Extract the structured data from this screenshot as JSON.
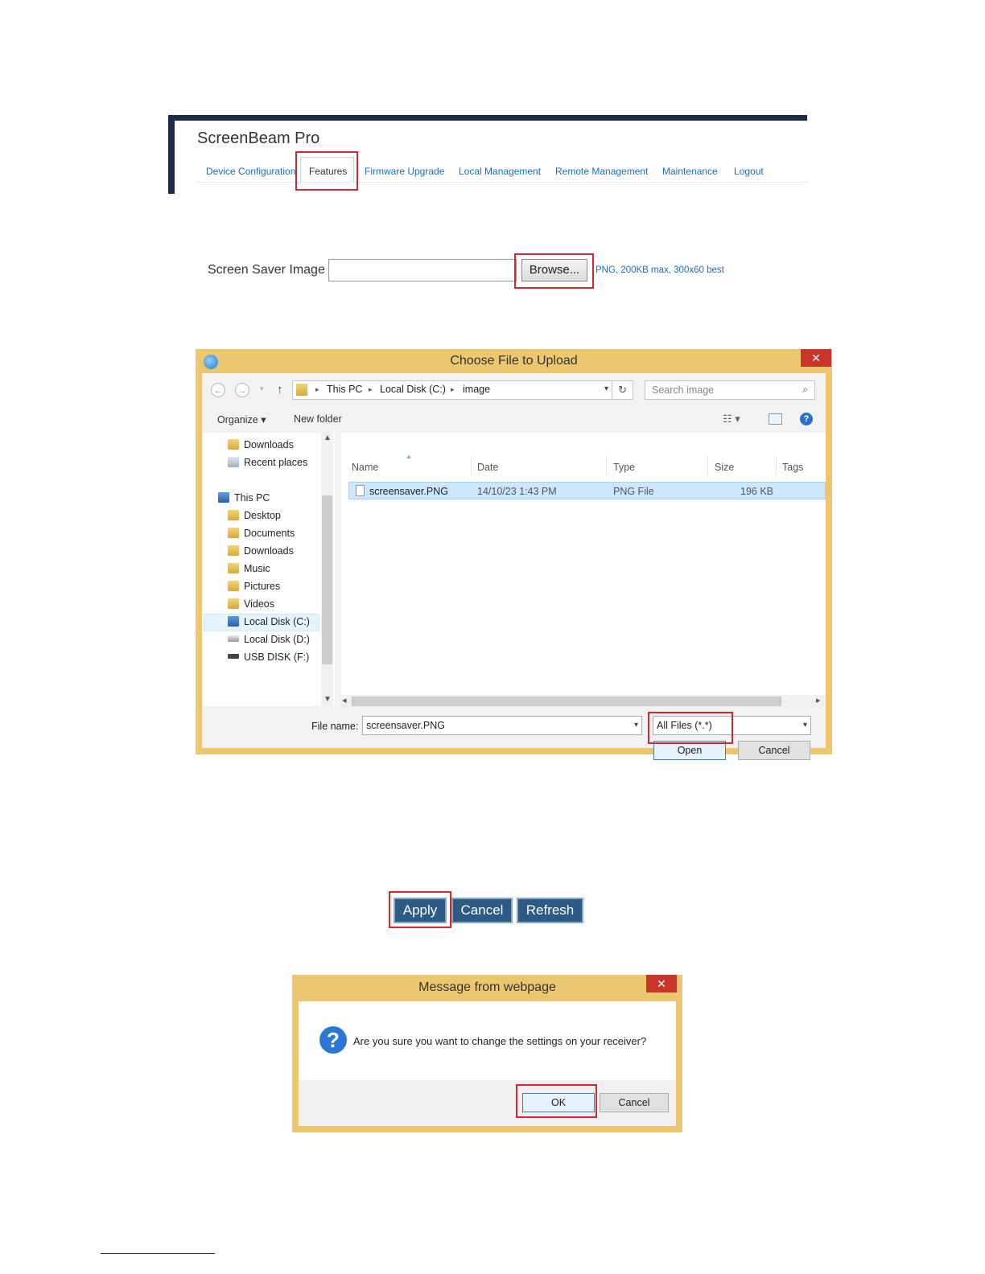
{
  "header": {
    "title": "ScreenBeam Pro",
    "nav": [
      "Device Configuration",
      "Features",
      "Firmware Upgrade",
      "Local Management",
      "Remote Management",
      "Maintenance",
      "Logout"
    ]
  },
  "screen_saver": {
    "label": "Screen Saver Image",
    "input_value": "",
    "browse_label": "Browse...",
    "hint": "PNG, 200KB max, 300x60 best"
  },
  "file_dialog": {
    "title": "Choose File to Upload",
    "close": "✕",
    "breadcrumb": [
      "This PC",
      "Local Disk (C:)",
      "image"
    ],
    "search_placeholder": "Search image",
    "toolbar": {
      "organize": "Organize ▾",
      "new_folder": "New folder"
    },
    "sidebar": {
      "favorites": [
        "Downloads",
        "Recent places"
      ],
      "this_pc": "This PC",
      "pc_items": [
        "Desktop",
        "Documents",
        "Downloads",
        "Music",
        "Pictures",
        "Videos",
        "Local Disk (C:)",
        "Local Disk (D:)",
        "USB DISK (F:)"
      ]
    },
    "columns": [
      "Name",
      "Date",
      "Type",
      "Size",
      "Tags"
    ],
    "rows": [
      {
        "name": "screensaver.PNG",
        "date": "14/10/23 1:43 PM",
        "type": "PNG File",
        "size": "196 KB",
        "tags": ""
      }
    ],
    "file_name_label": "File name:",
    "file_name_value": "screensaver.PNG",
    "file_type": "All Files (*.*)",
    "open_label": "Open",
    "cancel_label": "Cancel"
  },
  "actions": {
    "apply": "Apply",
    "cancel": "Cancel",
    "refresh": "Refresh"
  },
  "message_box": {
    "title": "Message from webpage",
    "close": "✕",
    "message": "Are you sure you want to change the settings on your receiver?",
    "ok_label": "OK",
    "cancel_label": "Cancel"
  },
  "colors": {
    "accent_blue": "#2e5a86",
    "link_blue": "#1a6fc0",
    "highlight_red": "#d9252f",
    "dialog_frame": "#ecc770",
    "header_navy": "#1c2b48"
  },
  "icons": [
    "ie-icon",
    "back-arrow-icon",
    "forward-arrow-icon",
    "up-arrow-icon",
    "folder-icon",
    "refresh-icon",
    "search-icon",
    "view-icon",
    "pane-icon",
    "help-icon",
    "question-icon",
    "close-icon"
  ]
}
